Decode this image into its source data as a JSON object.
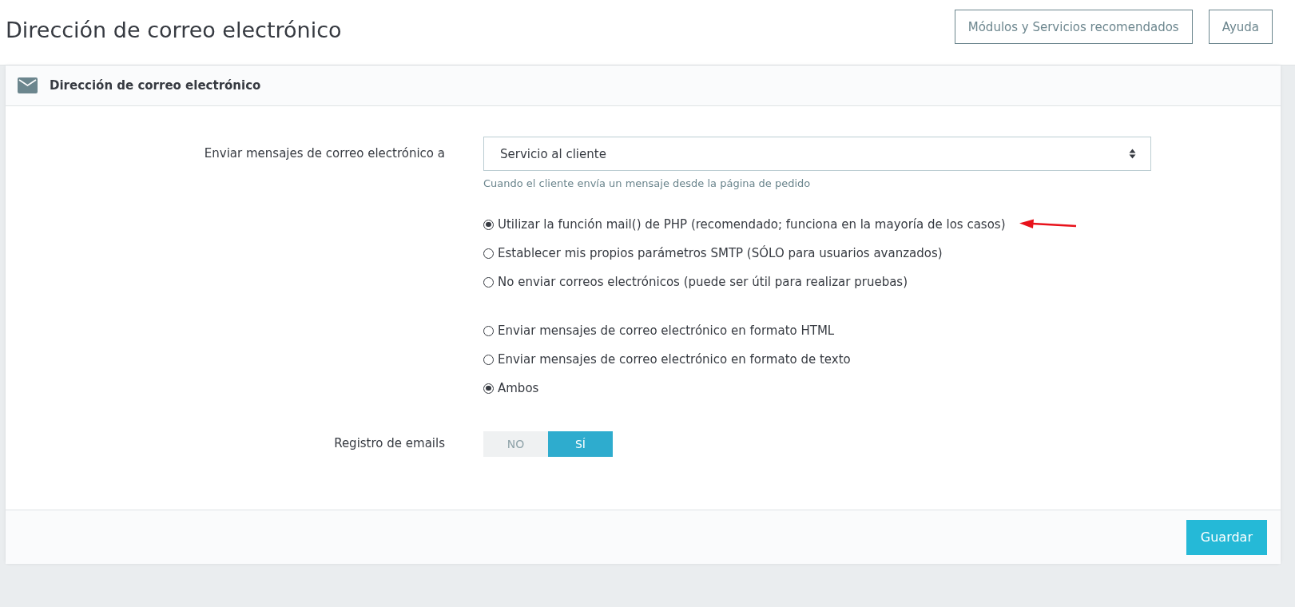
{
  "page_title": "Dirección de correo electrónico",
  "header_buttons": [
    "Módulos y Servicios recomendados",
    "Ayuda"
  ],
  "panel": {
    "title": "Dirección de correo electrónico",
    "send_to": {
      "label": "Enviar mensajes de correo electrónico a",
      "value": "Servicio al cliente",
      "help": "Cuando el cliente envía un mensaje desde la página de pedido"
    },
    "radio_groups": [
      [
        {
          "label": "Utilizar la función mail() de PHP (recomendado; funciona en la mayoría de los casos)",
          "selected": true
        },
        {
          "label": "Establecer mis propios parámetros SMTP (SÓLO para usuarios avanzados)",
          "selected": false
        },
        {
          "label": "No enviar correos electrónicos (puede ser útil para realizar pruebas)",
          "selected": false
        }
      ],
      [
        {
          "label": "Enviar mensajes de correo electrónico en formato HTML",
          "selected": false
        },
        {
          "label": "Enviar mensajes de correo electrónico en formato de texto",
          "selected": false
        },
        {
          "label": "Ambos",
          "selected": true
        }
      ]
    ],
    "email_log": {
      "label": "Registro de emails",
      "options": [
        {
          "label": "NO",
          "selected": false
        },
        {
          "label": "SÍ",
          "selected": true
        }
      ]
    },
    "save_button": "Guardar"
  }
}
